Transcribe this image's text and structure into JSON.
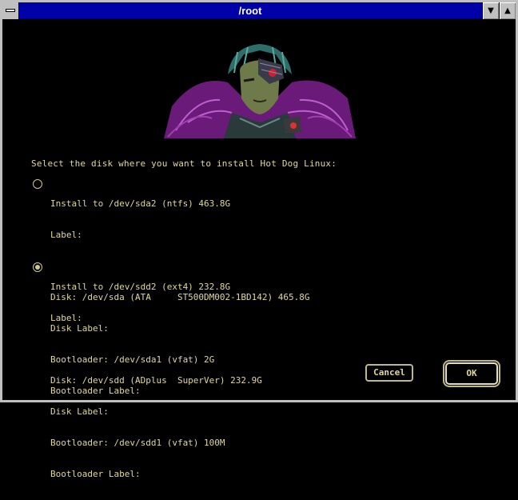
{
  "window": {
    "title": "/root",
    "sysmenu_icon": "system-menu-icon",
    "minimize_glyph": "▼",
    "maximize_glyph": "▲"
  },
  "prompt": "Select the disk where you want to install Hot Dog Linux:",
  "options": [
    {
      "selected": false,
      "lines": [
        "Install to /dev/sda2 (ntfs) 463.8G",
        "Label:",
        "",
        "Disk: /dev/sda (ATA     ST500DM002-1BD142) 465.8G",
        "Disk Label:",
        "Bootloader: /dev/sda1 (vfat) 2G",
        "Bootloader Label:"
      ]
    },
    {
      "selected": true,
      "lines": [
        "Install to /dev/sdd2 (ext4) 232.8G",
        "Label:",
        "",
        "Disk: /dev/sdd (ADplus  SuperVer) 232.9G",
        "Disk Label:",
        "Bootloader: /dev/sdd1 (vfat) 100M",
        "Bootloader Label:"
      ]
    }
  ],
  "buttons": {
    "cancel": "Cancel",
    "ok": "OK"
  },
  "colors": {
    "titlebar": "#0000a8",
    "text": "#e0d8a0",
    "background": "#000000"
  }
}
